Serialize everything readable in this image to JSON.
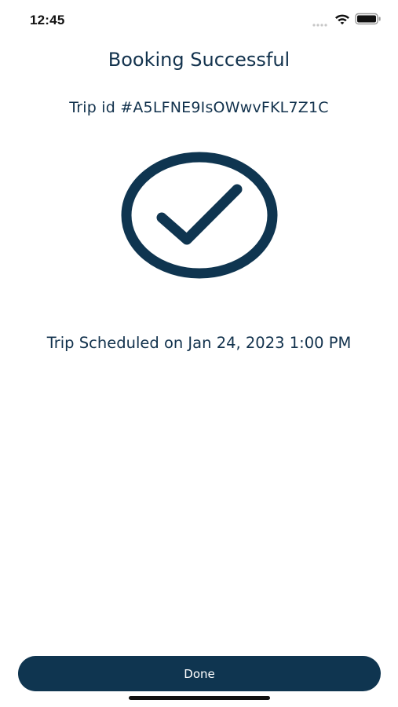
{
  "status_bar": {
    "time": "12:45",
    "icons": [
      "signal-icon",
      "wifi-icon",
      "battery-icon"
    ]
  },
  "header": {
    "title": "Booking Successful"
  },
  "trip": {
    "id_text": "Trip id #A5LFNE9IsOWwvFKL7Z1C",
    "scheduled_text": "Trip Scheduled on Jan 24, 2023 1:00 PM"
  },
  "success_icon": {
    "name": "check-circle-icon",
    "color": "#0f3550"
  },
  "actions": {
    "done_label": "Done"
  },
  "colors": {
    "primary": "#0f3550",
    "text": "#12324d",
    "background": "#ffffff"
  }
}
